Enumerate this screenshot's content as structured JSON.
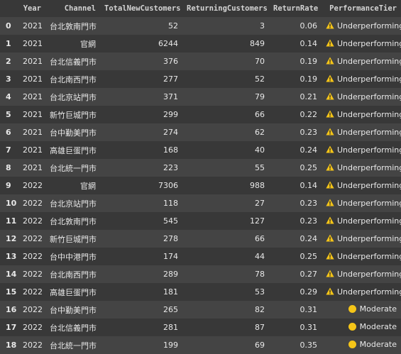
{
  "table": {
    "columns": [
      "",
      "Year",
      "Channel",
      "TotalNewCustomers",
      "ReturningCustomers",
      "ReturnRate",
      "PerformanceTier"
    ],
    "rows": [
      {
        "index": "0",
        "year": "2021",
        "channel": "台北敦南門市",
        "new": "52",
        "returning": "3",
        "rate": "0.06",
        "tier": "Underperforming",
        "tier_icon": "warning-icon"
      },
      {
        "index": "1",
        "year": "2021",
        "channel": "官網",
        "new": "6244",
        "returning": "849",
        "rate": "0.14",
        "tier": "Underperforming",
        "tier_icon": "warning-icon"
      },
      {
        "index": "2",
        "year": "2021",
        "channel": "台北信義門市",
        "new": "376",
        "returning": "70",
        "rate": "0.19",
        "tier": "Underperforming",
        "tier_icon": "warning-icon"
      },
      {
        "index": "3",
        "year": "2021",
        "channel": "台北南西門市",
        "new": "277",
        "returning": "52",
        "rate": "0.19",
        "tier": "Underperforming",
        "tier_icon": "warning-icon"
      },
      {
        "index": "4",
        "year": "2021",
        "channel": "台北京站門市",
        "new": "371",
        "returning": "79",
        "rate": "0.21",
        "tier": "Underperforming",
        "tier_icon": "warning-icon"
      },
      {
        "index": "5",
        "year": "2021",
        "channel": "新竹巨城門市",
        "new": "299",
        "returning": "66",
        "rate": "0.22",
        "tier": "Underperforming",
        "tier_icon": "warning-icon"
      },
      {
        "index": "6",
        "year": "2021",
        "channel": "台中勤美門市",
        "new": "274",
        "returning": "62",
        "rate": "0.23",
        "tier": "Underperforming",
        "tier_icon": "warning-icon"
      },
      {
        "index": "7",
        "year": "2021",
        "channel": "高雄巨蛋門市",
        "new": "168",
        "returning": "40",
        "rate": "0.24",
        "tier": "Underperforming",
        "tier_icon": "warning-icon"
      },
      {
        "index": "8",
        "year": "2021",
        "channel": "台北統一門市",
        "new": "223",
        "returning": "55",
        "rate": "0.25",
        "tier": "Underperforming",
        "tier_icon": "warning-icon"
      },
      {
        "index": "9",
        "year": "2022",
        "channel": "官網",
        "new": "7306",
        "returning": "988",
        "rate": "0.14",
        "tier": "Underperforming",
        "tier_icon": "warning-icon"
      },
      {
        "index": "10",
        "year": "2022",
        "channel": "台北京站門市",
        "new": "118",
        "returning": "27",
        "rate": "0.23",
        "tier": "Underperforming",
        "tier_icon": "warning-icon"
      },
      {
        "index": "11",
        "year": "2022",
        "channel": "台北敦南門市",
        "new": "545",
        "returning": "127",
        "rate": "0.23",
        "tier": "Underperforming",
        "tier_icon": "warning-icon"
      },
      {
        "index": "12",
        "year": "2022",
        "channel": "新竹巨城門市",
        "new": "278",
        "returning": "66",
        "rate": "0.24",
        "tier": "Underperforming",
        "tier_icon": "warning-icon"
      },
      {
        "index": "13",
        "year": "2022",
        "channel": "台中中港門市",
        "new": "174",
        "returning": "44",
        "rate": "0.25",
        "tier": "Underperforming",
        "tier_icon": "warning-icon"
      },
      {
        "index": "14",
        "year": "2022",
        "channel": "台北南西門市",
        "new": "289",
        "returning": "78",
        "rate": "0.27",
        "tier": "Underperforming",
        "tier_icon": "warning-icon"
      },
      {
        "index": "15",
        "year": "2022",
        "channel": "高雄巨蛋門市",
        "new": "181",
        "returning": "53",
        "rate": "0.29",
        "tier": "Underperforming",
        "tier_icon": "warning-icon"
      },
      {
        "index": "16",
        "year": "2022",
        "channel": "台中勤美門市",
        "new": "265",
        "returning": "82",
        "rate": "0.31",
        "tier": "Moderate",
        "tier_icon": "yellow-circle-icon"
      },
      {
        "index": "17",
        "year": "2022",
        "channel": "台北信義門市",
        "new": "281",
        "returning": "87",
        "rate": "0.31",
        "tier": "Moderate",
        "tier_icon": "yellow-circle-icon"
      },
      {
        "index": "18",
        "year": "2022",
        "channel": "台北統一門市",
        "new": "199",
        "returning": "69",
        "rate": "0.35",
        "tier": "Moderate",
        "tier_icon": "yellow-circle-icon"
      }
    ]
  },
  "colors": {
    "background": "#383838",
    "row_alt": "#444444",
    "warning": "#f5c518",
    "moderate_dot": "#f5c518"
  }
}
